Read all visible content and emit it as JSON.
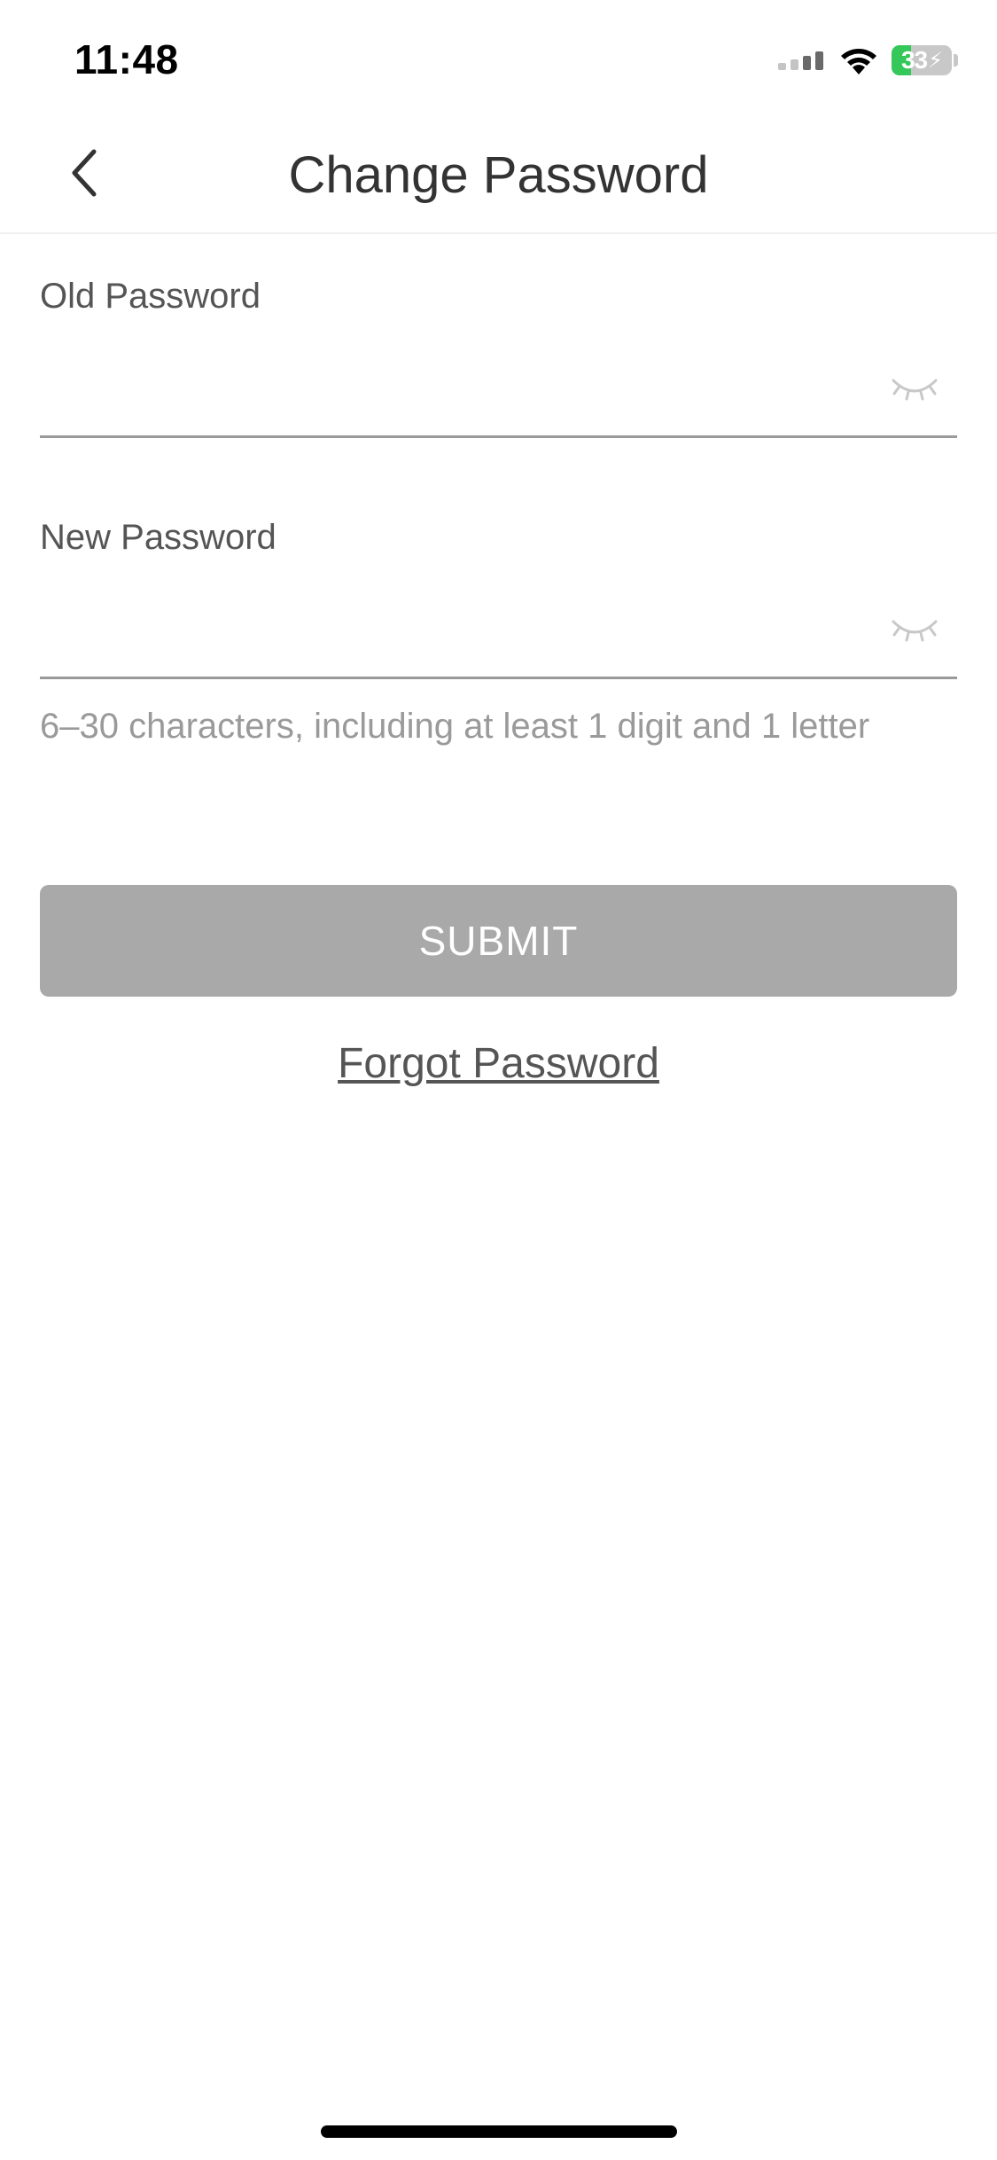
{
  "status_bar": {
    "time": "11:48",
    "battery_percent": "33",
    "battery_level": 0.33,
    "icons": [
      "cellular-signal-icon",
      "wifi-icon",
      "battery-charging-icon"
    ]
  },
  "nav": {
    "title": "Change Password",
    "back_icon": "chevron-left-icon"
  },
  "form": {
    "old_password": {
      "label": "Old Password",
      "value": "",
      "placeholder": "",
      "toggle_icon": "eye-closed-icon"
    },
    "new_password": {
      "label": "New Password",
      "value": "",
      "placeholder": "",
      "toggle_icon": "eye-closed-icon",
      "hint": "6–30 characters, including at least 1 digit and 1 letter"
    },
    "submit_label": "SUBMIT",
    "forgot_label": "Forgot Password"
  },
  "colors": {
    "battery_green": "#34c759",
    "submit_disabled": "#a9a9a9",
    "hint_gray": "#9a9a9a",
    "title_text": "#333333"
  }
}
